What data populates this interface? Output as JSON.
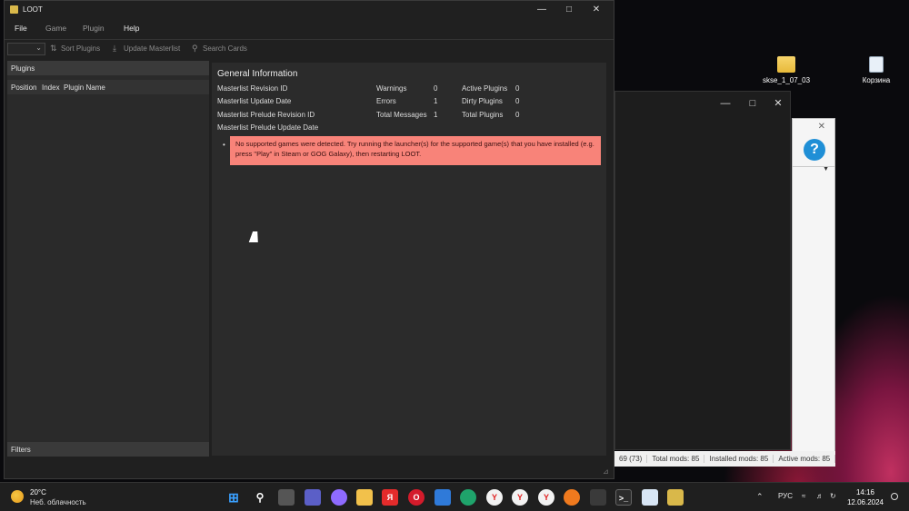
{
  "desktop": {
    "icons": [
      {
        "label": "skse_1_07_03",
        "icon": "folder-icon"
      },
      {
        "label": "Корзина",
        "icon": "recycle-bin-icon"
      }
    ]
  },
  "background_window": {
    "status": [
      "69 (73)",
      "Total mods: 85",
      "Installed mods: 85",
      "Active mods: 85"
    ]
  },
  "loot": {
    "title": "LOOT",
    "menu": [
      "File",
      "Game",
      "Plugin",
      "Help"
    ],
    "toolbar": {
      "sort": "Sort Plugins",
      "update": "Update Masterlist",
      "search": "Search Cards"
    },
    "plugins_header": "Plugins",
    "columns": [
      "Position",
      "Index",
      "Plugin Name"
    ],
    "filters": "Filters",
    "general": {
      "title": "General Information",
      "rows": [
        {
          "label": "Masterlist Revision ID"
        },
        {
          "label": "Masterlist Update Date"
        },
        {
          "label": "Masterlist Prelude Revision ID"
        },
        {
          "label": "Masterlist Prelude Update Date"
        }
      ],
      "counts": [
        {
          "label": "Warnings",
          "value": "0"
        },
        {
          "label": "Errors",
          "value": "1"
        },
        {
          "label": "Total Messages",
          "value": "1"
        }
      ],
      "plugins": [
        {
          "label": "Active Plugins",
          "value": "0"
        },
        {
          "label": "Dirty Plugins",
          "value": "0"
        },
        {
          "label": "Total Plugins",
          "value": "0"
        }
      ],
      "message": "No supported games were detected. Try running the launcher(s) for the supported game(s) that you have installed (e.g. press \"Play\" in Steam or GOG Galaxy), then restarting LOOT."
    }
  },
  "taskbar": {
    "weather": {
      "temp": "20°C",
      "condition": "Неб. облачность"
    },
    "language": "РУС",
    "time": "14:16",
    "date": "12.06.2024"
  },
  "colors": {
    "error_bg": "#f88379",
    "panel_bg": "#2b2b2b",
    "taskbar_bg": "#1f1f1f"
  }
}
